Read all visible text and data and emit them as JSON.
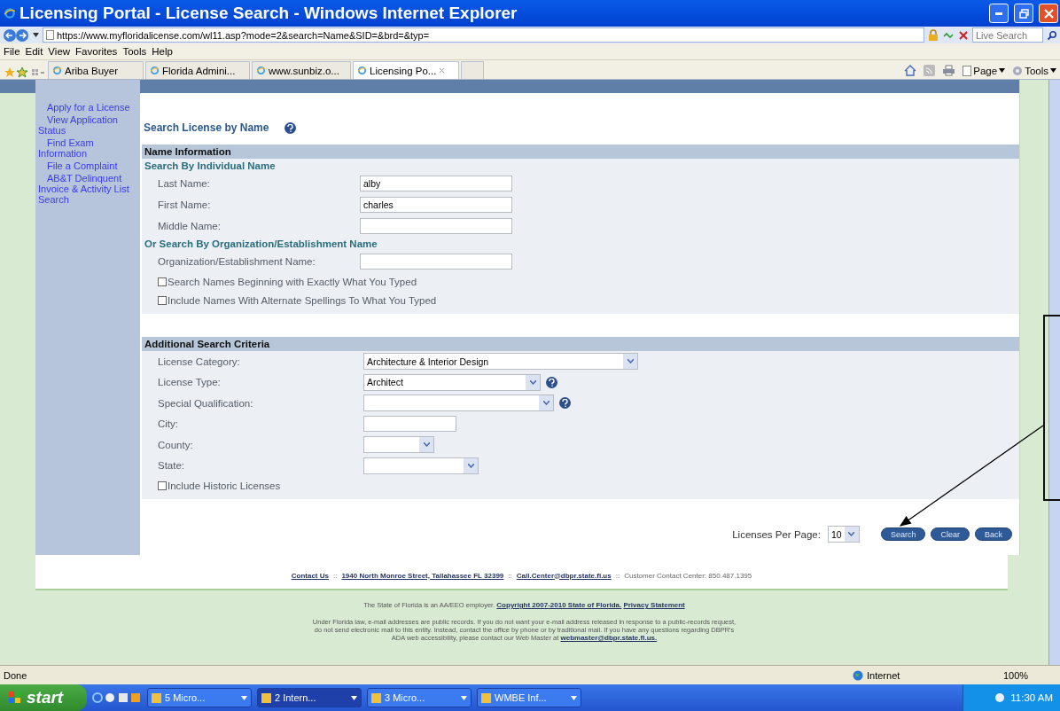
{
  "window": {
    "title": "Licensing Portal - License Search - Windows Internet Explorer"
  },
  "address_bar": {
    "url": "https://www.myfloridalicense.com/wl11.asp?mode=2&search=Name&SID=&brd=&typ="
  },
  "search_box": {
    "placeholder": "Live Search"
  },
  "menu": [
    "File",
    "Edit",
    "View",
    "Favorites",
    "Tools",
    "Help"
  ],
  "tabs": [
    {
      "label": "Ariba Buyer",
      "selected": false
    },
    {
      "label": "Florida Admini...",
      "selected": false
    },
    {
      "label": "www.sunbiz.o...",
      "selected": false
    },
    {
      "label": "Licensing Po...",
      "selected": true
    }
  ],
  "command_bar": [
    "Page",
    "Tools"
  ],
  "sidebar": {
    "items": [
      "Apply for a License",
      "View Application Status",
      "Find Exam Information",
      "File a Complaint",
      "AB&T Delinquent Invoice & Activity List Search"
    ]
  },
  "form": {
    "title": "Search License by Name",
    "name_section": {
      "title": "Name Information",
      "individual_heading": "Search By Individual Name",
      "individual_fields": [
        {
          "label": "Last Name:",
          "value": "alby"
        },
        {
          "label": "First Name:",
          "value": "charles"
        },
        {
          "label": "Middle Name:"
        }
      ],
      "organization_heading": "Or Search By Organization/Establishment Name",
      "organization_fields": [
        {
          "label": "Organization/Establishment Name:"
        }
      ],
      "options": [
        {
          "label": "Search Names Beginning with Exactly What You Typed",
          "checked": false
        },
        {
          "label": "Include Names With Alternate Spellings To What You Typed",
          "checked": false
        }
      ]
    },
    "criteria_section": {
      "title": "Additional Search Criteria",
      "fields": [
        {
          "kind": "select",
          "label": "License Category:",
          "value": "Architecture & Interior Design",
          "help": false
        },
        {
          "kind": "select",
          "label": "License Type:",
          "value": "Architect",
          "help": true
        },
        {
          "kind": "select",
          "label": "Special Qualification:",
          "help": true
        },
        {
          "kind": "text",
          "label": "City:",
          "help": false
        },
        {
          "kind": "select",
          "label": "County:",
          "help": false
        },
        {
          "kind": "select",
          "label": "State:",
          "help": false
        }
      ],
      "options": [
        {
          "label": "Include Historic Licenses",
          "checked": false
        }
      ]
    },
    "per_page": {
      "label": "Licenses Per Page:",
      "value": "10"
    },
    "buttons": [
      "Search",
      "Clear",
      "Back"
    ]
  },
  "footer": {
    "links": [
      "Contact Us",
      "1940 North Monroe Street, Tallahassee FL 32399",
      "Call.Center@dbpr.state.fl.us"
    ],
    "separator": "::",
    "contact": "Customer Contact Center: 850.487.1395",
    "employer_note": "The State of Florida is an AA/EEO employer.",
    "legal_links": [
      "Copyright 2007-2010 State of Florida.",
      "Privacy Statement"
    ],
    "disclaimer": "Under Florida law, e-mail addresses are public records. If you do not want your e-mail address released in response to a public-records request, do not send electronic mail to this entity. Instead, contact the office by phone or by traditional mail. If you have any questions regarding DBPR's ADA web accessibility, please contact our Web Master at",
    "webmaster": "webmaster@dbpr.state.fl.us."
  },
  "status_bar": {
    "status": "Done",
    "zone": "Internet",
    "zoom": "100%"
  },
  "taskbar": {
    "start": "start",
    "items": [
      {
        "label": "5 Micro...",
        "selected": false
      },
      {
        "label": "2 Intern...",
        "selected": true
      },
      {
        "label": "3 Micro...",
        "selected": false
      },
      {
        "label": "WMBE Inf...",
        "selected": false
      }
    ],
    "clock": "11:30 AM"
  }
}
